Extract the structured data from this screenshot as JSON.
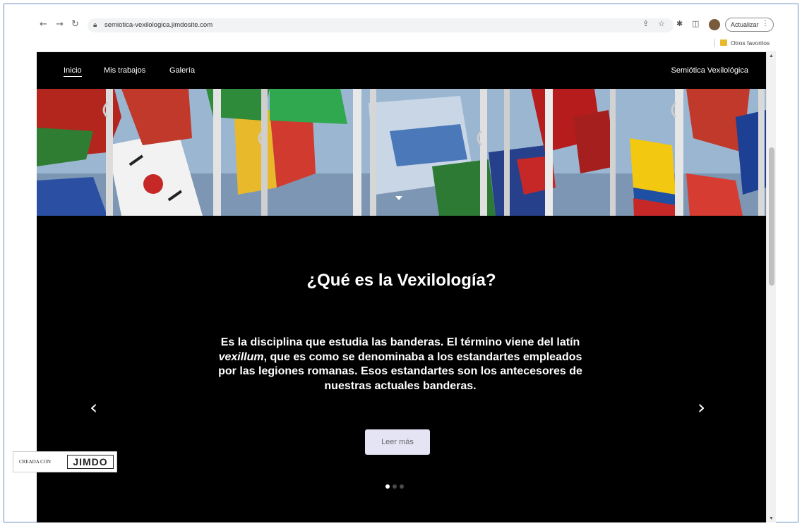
{
  "browser": {
    "url": "semiotica-vexilologica.jimdosite.com",
    "update_label": "Actualizar",
    "bookmark_folder_label": "Otros favoritos"
  },
  "site": {
    "nav": [
      {
        "label": "Inicio",
        "active": true
      },
      {
        "label": "Mis trabajos",
        "active": false
      },
      {
        "label": "Galería",
        "active": false
      }
    ],
    "brand": "Semiótica Vexilológica"
  },
  "slide": {
    "title": "¿Qué es la Vexilología?",
    "text_before": "Es la disciplina que estudia las banderas. El término viene del latín ",
    "text_italic": "vexillum",
    "text_after": ", que es como se denominaba a los estandartes empleados por las legiones romanas. Esos estandartes son los antecesores de nuestras actuales banderas.",
    "button_label": "Leer más",
    "prev_arrow": "‹",
    "next_arrow": "›",
    "active_dot": 1,
    "dot_count": 3
  },
  "footer_badge": {
    "small_text": "CREADA CON",
    "logo_text": "JIMDO"
  },
  "colors": {
    "page_bg": "#000000",
    "button_bg": "#e4e4f4",
    "frame_border": "#6b8fc7"
  }
}
